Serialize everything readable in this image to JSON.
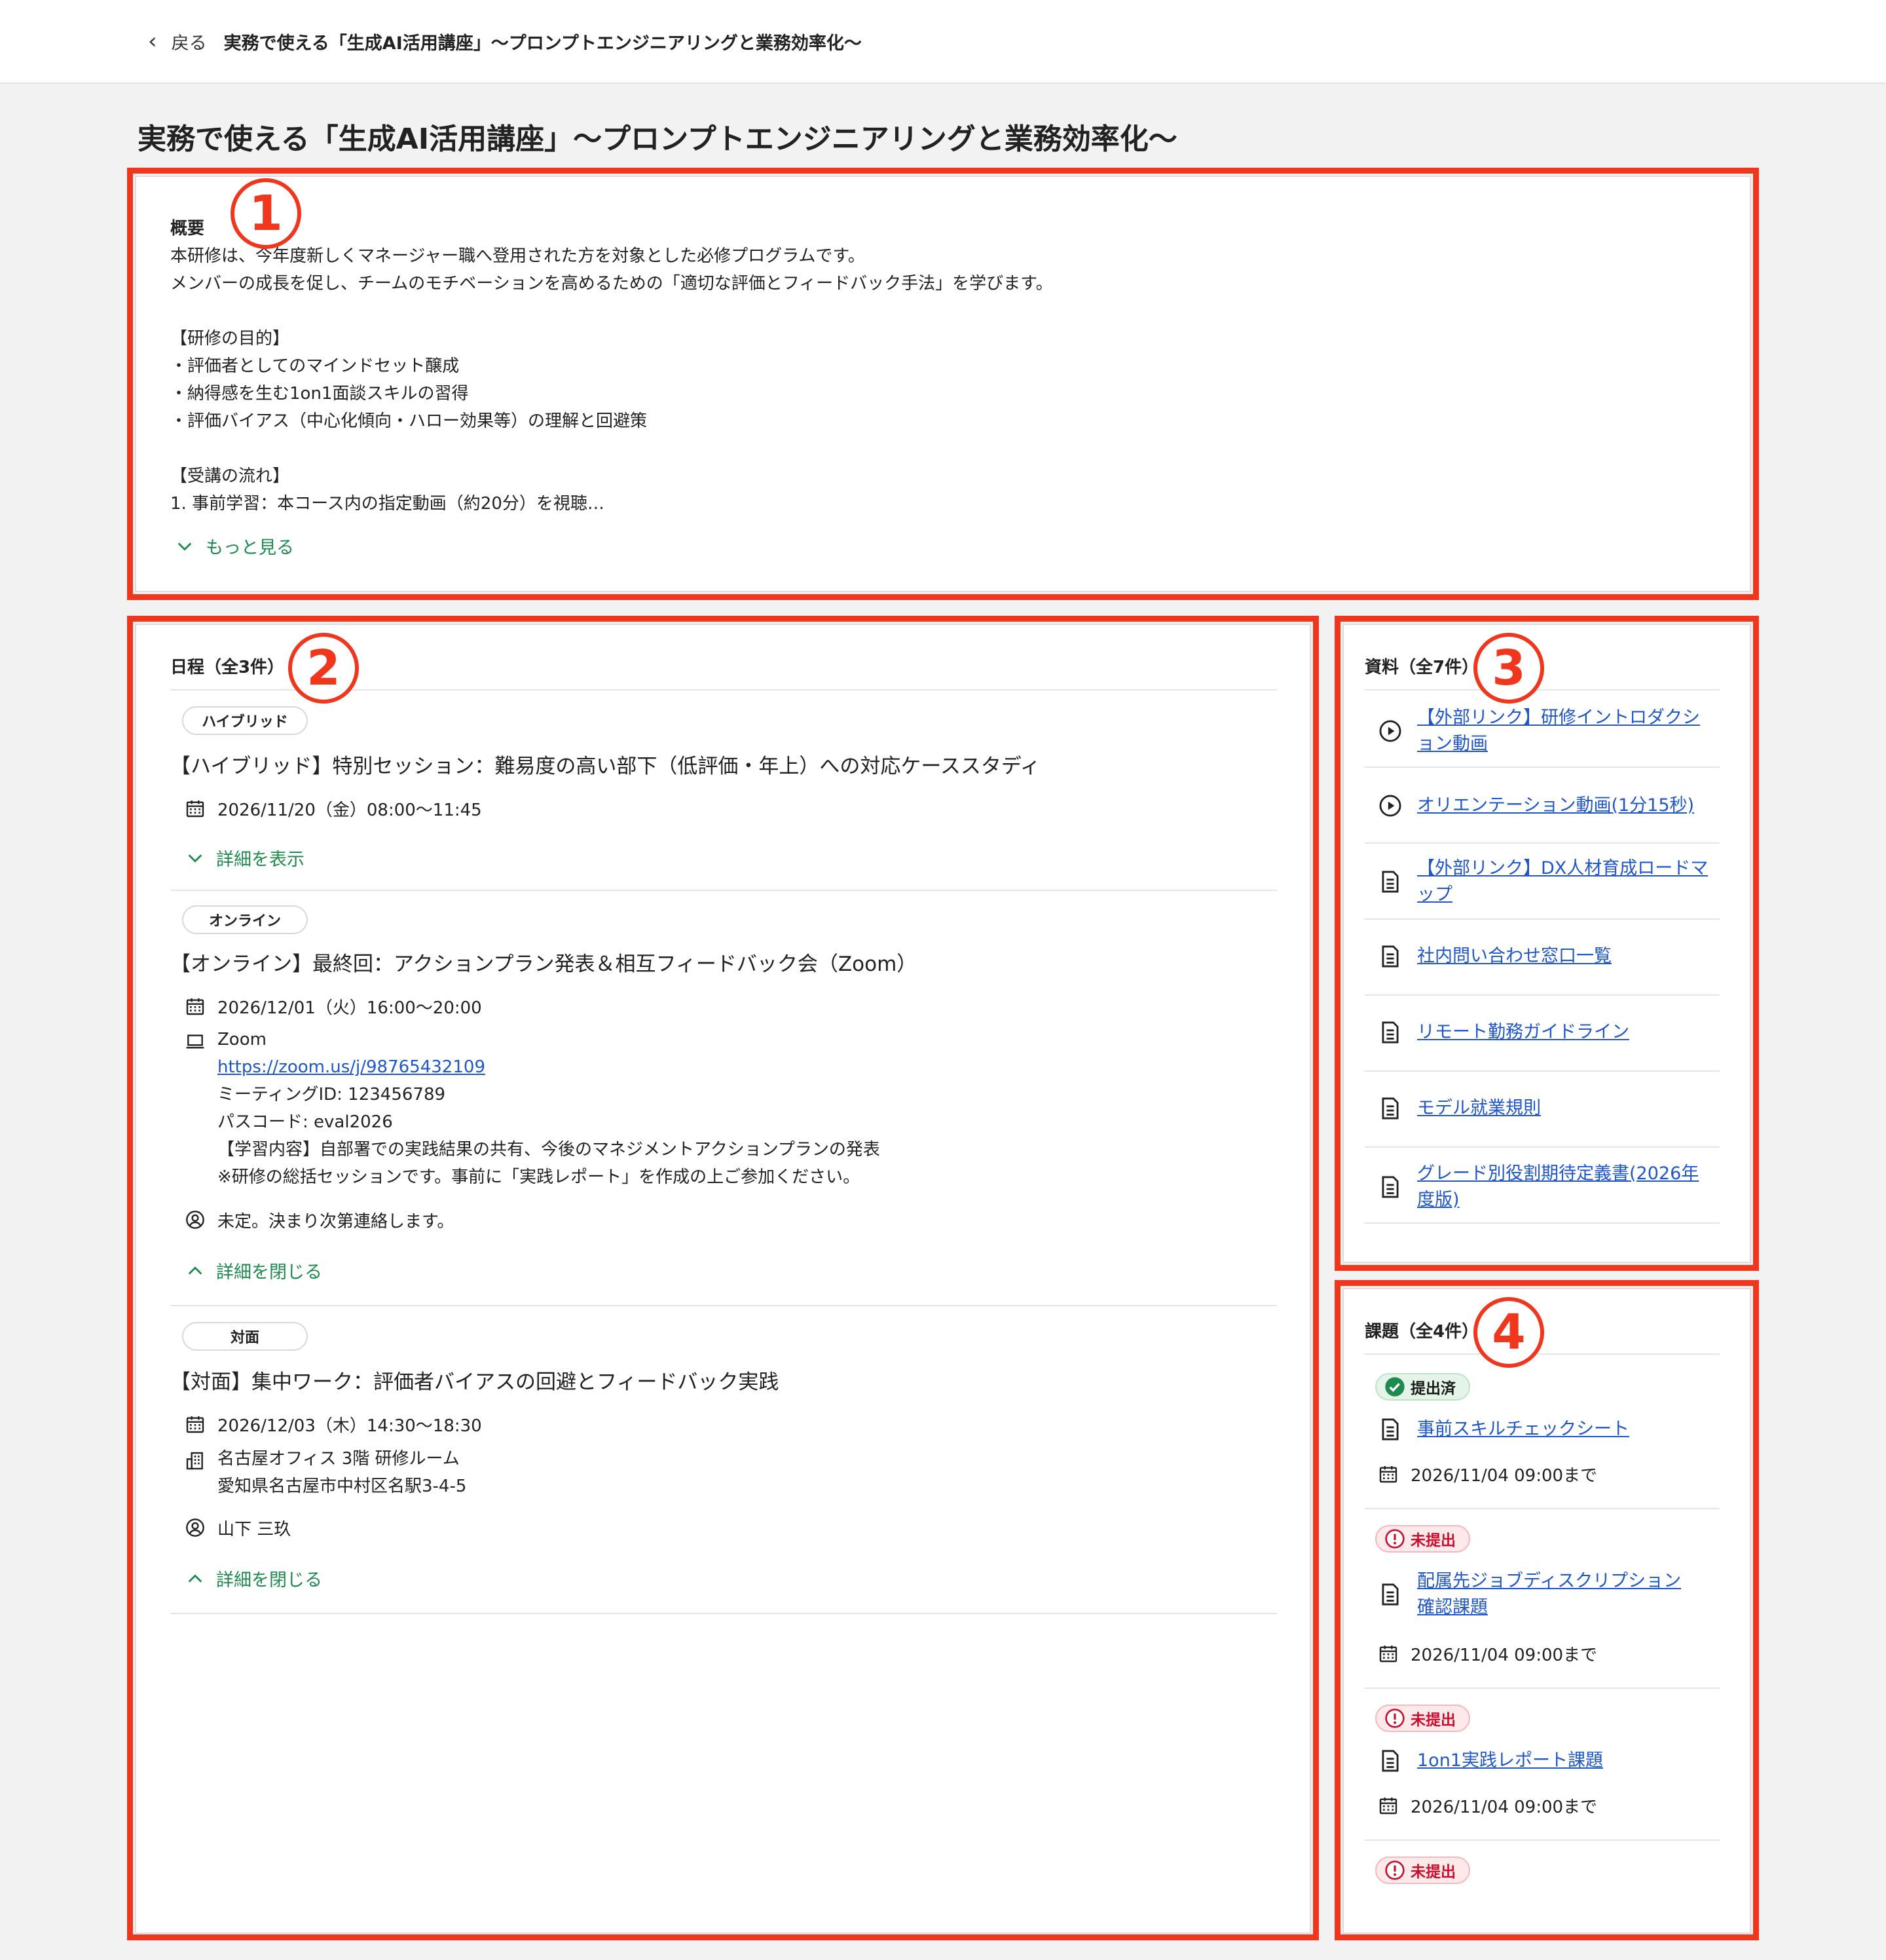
{
  "header": {
    "back_label": "戻る",
    "breadcrumb": "実務で使える「生成AI活用講座」〜プロンプトエンジニアリングと業務効率化〜"
  },
  "page": {
    "title": "実務で使える「生成AI活用講座」〜プロンプトエンジニアリングと業務効率化〜"
  },
  "annotations": {
    "n1": "1",
    "n2": "2",
    "n3": "3",
    "n4": "4"
  },
  "overview": {
    "title": "概要",
    "body": "本研修は、今年度新しくマネージャー職へ登用された方を対象とした必修プログラムです。\nメンバーの成長を促し、チームのモチベーションを高めるための「適切な評価とフィードバック手法」を学びます。\n\n【研修の目的】\n・評価者としてのマインドセット醸成\n・納得感を生む1on1面談スキルの習得\n・評価バイアス（中心化傾向・ハロー効果等）の理解と回避策\n\n【受講の流れ】\n1. 事前学習：本コース内の指定動画（約20分）を視聴…",
    "more_label": "もっと見る"
  },
  "schedule": {
    "title": "日程（全3件）",
    "events": [
      {
        "tag": "ハイブリッド",
        "title": "【ハイブリッド】特別セッション：難易度の高い部下（低評価・年上）への対応ケーススタディ",
        "datetime": "2026/11/20（金）08:00〜11:45",
        "toggle": "詳細を表示"
      },
      {
        "tag": "オンライン",
        "title": "【オンライン】最終回：アクションプラン発表＆相互フィードバック会（Zoom）",
        "datetime": "2026/12/01（火）16:00〜20:00",
        "location_name": "Zoom",
        "url": "https://zoom.us/j/98765432109",
        "meeting_id": "ミーティングID: 123456789",
        "passcode": "パスコード: eval2026",
        "content": "【学習内容】自部署での実践結果の共有、今後のマネジメントアクションプランの発表",
        "note": "※研修の総括セッションです。事前に「実践レポート」を作成の上ご参加ください。",
        "instructor": "未定。決まり次第連絡します。",
        "toggle": "詳細を閉じる"
      },
      {
        "tag": "対面",
        "title": "【対面】集中ワーク：評価者バイアスの回避とフィードバック実践",
        "datetime": "2026/12/03（木）14:30〜18:30",
        "place": "名古屋オフィス 3階 研修ルーム",
        "address": "愛知県名古屋市中村区名駅3-4-5",
        "instructor": "山下 三玖",
        "toggle": "詳細を閉じる"
      }
    ]
  },
  "materials": {
    "title": "資料（全7件）",
    "items": [
      {
        "icon": "play-icon",
        "label": "【外部リンク】研修イントロダクシ\nョン動画"
      },
      {
        "icon": "play-icon",
        "label": "オリエンテーション動画(1分15秒)"
      },
      {
        "icon": "document-icon",
        "label": "【外部リンク】DX人材育成ロードマ\nップ"
      },
      {
        "icon": "document-icon",
        "label": "社内問い合わせ窓口一覧"
      },
      {
        "icon": "document-icon",
        "label": "リモート勤務ガイドライン"
      },
      {
        "icon": "document-icon",
        "label": "モデル就業規則"
      },
      {
        "icon": "document-icon",
        "label": "グレード別役割期待定義書(2026年\n度版)"
      }
    ]
  },
  "assignments": {
    "title": "課題（全4件）",
    "items": [
      {
        "status": "提出済",
        "label": "事前スキルチェックシート",
        "due": "2026/11/04 09:00まで"
      },
      {
        "status": "未提出",
        "label": "配属先ジョブディスクリプション\n確認課題",
        "due": "2026/11/04 09:00まで"
      },
      {
        "status": "未提出",
        "label": "1on1実践レポート課題",
        "due": "2026/11/04 09:00まで"
      },
      {
        "status": "未提出"
      }
    ]
  },
  "colors": {
    "accent_green": "#1d8a4e",
    "link_blue": "#1f56c8",
    "annotation_red": "#f0361c",
    "error_red": "#c8102e"
  }
}
